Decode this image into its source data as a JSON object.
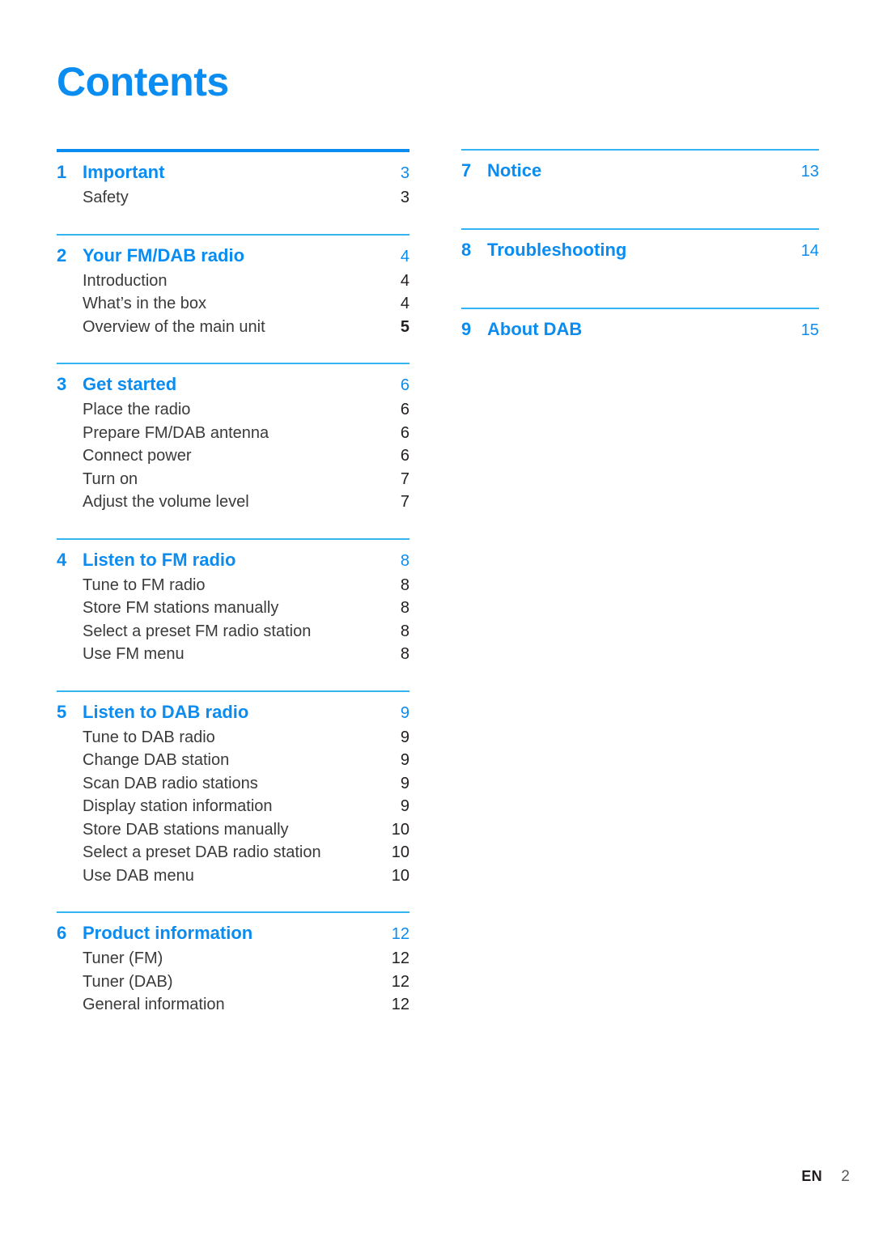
{
  "document": {
    "title": "Contents"
  },
  "colors": {
    "accent_blue": "#0a8cf0",
    "rule_blue": "#33b5f2",
    "body_text": "#3a3a3a"
  },
  "toc": {
    "left_column": [
      {
        "number": "1",
        "title": "Important",
        "page": "3",
        "rule": "thick",
        "entries": [
          {
            "label": "Safety",
            "page": "3",
            "bold_page": false
          }
        ]
      },
      {
        "number": "2",
        "title": "Your FM/DAB radio",
        "page": "4",
        "rule": "thin",
        "entries": [
          {
            "label": "Introduction",
            "page": "4",
            "bold_page": false
          },
          {
            "label": "What’s in the box",
            "page": "4",
            "bold_page": false
          },
          {
            "label": "Overview of the main unit",
            "page": "5",
            "bold_page": true
          }
        ]
      },
      {
        "number": "3",
        "title": "Get started",
        "page": "6",
        "rule": "thin",
        "entries": [
          {
            "label": "Place the radio",
            "page": "6",
            "bold_page": false
          },
          {
            "label": "Prepare FM/DAB antenna",
            "page": "6",
            "bold_page": false
          },
          {
            "label": "Connect power",
            "page": "6",
            "bold_page": false
          },
          {
            "label": "Turn on",
            "page": "7",
            "bold_page": false
          },
          {
            "label": "Adjust the volume level",
            "page": "7",
            "bold_page": false
          }
        ]
      },
      {
        "number": "4",
        "title": "Listen to FM radio",
        "page": "8",
        "rule": "thin",
        "entries": [
          {
            "label": "Tune to FM radio",
            "page": "8",
            "bold_page": false
          },
          {
            "label": "Store FM stations manually",
            "page": "8",
            "bold_page": false
          },
          {
            "label": "Select a preset FM radio station",
            "page": "8",
            "bold_page": false
          },
          {
            "label": "Use FM menu",
            "page": "8",
            "bold_page": false
          }
        ]
      },
      {
        "number": "5",
        "title": "Listen to DAB radio",
        "page": "9",
        "rule": "thin",
        "entries": [
          {
            "label": "Tune to DAB radio",
            "page": "9",
            "bold_page": false
          },
          {
            "label": "Change DAB station",
            "page": "9",
            "bold_page": false
          },
          {
            "label": "Scan DAB radio stations",
            "page": "9",
            "bold_page": false
          },
          {
            "label": "Display station information",
            "page": "9",
            "bold_page": false
          },
          {
            "label": "Store DAB stations manually",
            "page": "10",
            "bold_page": false
          },
          {
            "label": "Select a preset DAB radio station",
            "page": "10",
            "bold_page": false
          },
          {
            "label": "Use DAB menu",
            "page": "10",
            "bold_page": false
          }
        ]
      },
      {
        "number": "6",
        "title": "Product information",
        "page": "12",
        "rule": "thin",
        "entries": [
          {
            "label": "Tuner (FM)",
            "page": "12",
            "bold_page": false
          },
          {
            "label": "Tuner (DAB)",
            "page": "12",
            "bold_page": false
          },
          {
            "label": "General information",
            "page": "12",
            "bold_page": false
          }
        ]
      }
    ],
    "right_column": [
      {
        "number": "7",
        "title": "Notice",
        "page": "13",
        "rule": "thin",
        "entries": []
      },
      {
        "number": "8",
        "title": "Troubleshooting",
        "page": "14",
        "rule": "thin",
        "entries": []
      },
      {
        "number": "9",
        "title": "About DAB",
        "page": "15",
        "rule": "thin",
        "entries": []
      }
    ]
  },
  "footer": {
    "language": "EN",
    "page_number": "2"
  }
}
